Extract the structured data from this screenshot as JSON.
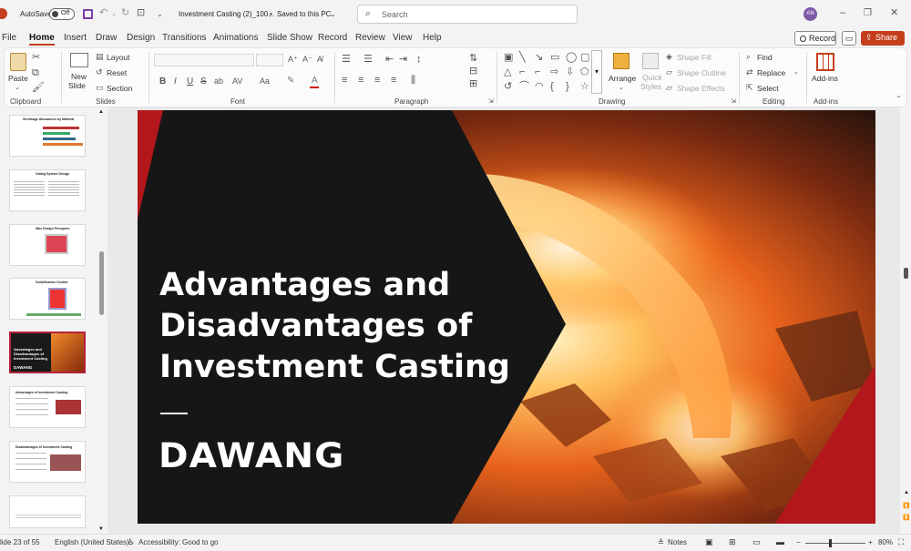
{
  "titlebar": {
    "autosave_label": "AutoSave",
    "autosave_state": "Off",
    "doc_title": "Investment Casting (2)_100...",
    "save_status": "Saved to this PC",
    "search_placeholder": "Search",
    "avatar_initials": "AN"
  },
  "tabs": [
    "File",
    "Home",
    "Insert",
    "Draw",
    "Design",
    "Transitions",
    "Animations",
    "Slide Show",
    "Record",
    "Review",
    "View",
    "Help"
  ],
  "right_buttons": {
    "record": "Record",
    "share": "Share"
  },
  "ribbon": {
    "clipboard": {
      "group": "Clipboard",
      "paste": "Paste"
    },
    "slides": {
      "group": "Slides",
      "new_slide": "New",
      "new_slide2": "Slide",
      "layout": "Layout",
      "reset": "Reset",
      "section": "Section"
    },
    "font": {
      "group": "Font"
    },
    "paragraph": {
      "group": "Paragraph"
    },
    "drawing": {
      "group": "Drawing",
      "arrange": "Arrange",
      "quick_styles": "Quick",
      "quick_styles2": "Styles",
      "shape_fill": "Shape Fill",
      "shape_outline": "Shape Outline",
      "shape_effects": "Shape Effects"
    },
    "editing": {
      "group": "Editing",
      "find": "Find",
      "replace": "Replace",
      "select": "Select"
    },
    "addins": {
      "group": "Add-ins",
      "label": "Add-ins"
    }
  },
  "thumbnails": [
    {
      "title": "Shrinkage Allowances by Material"
    },
    {
      "title": "Gating System Design"
    },
    {
      "title": "Wax Design Principles"
    },
    {
      "title": "Solidification Control"
    },
    {
      "title": "Advantages and Disadvantages of Investment Casting",
      "logo": "DAWANG"
    },
    {
      "title": "Advantages of Investment Casting"
    },
    {
      "title": "Disadvantages of Investment Casting"
    },
    {
      "title": ""
    }
  ],
  "slide": {
    "title_line1": "Advantages and",
    "title_line2": "Disadvantages of",
    "title_line3": "Investment Casting",
    "logo": "DAWANG"
  },
  "status": {
    "slide_info": "lide 23 of 55",
    "language": "English (United States)",
    "accessibility": "Accessibility: Good to go",
    "notes": "Notes",
    "zoom": "80%"
  },
  "colors": {
    "accent": "#c43e1c",
    "slide_dark": "#161616",
    "slide_red": "#b3161b"
  }
}
